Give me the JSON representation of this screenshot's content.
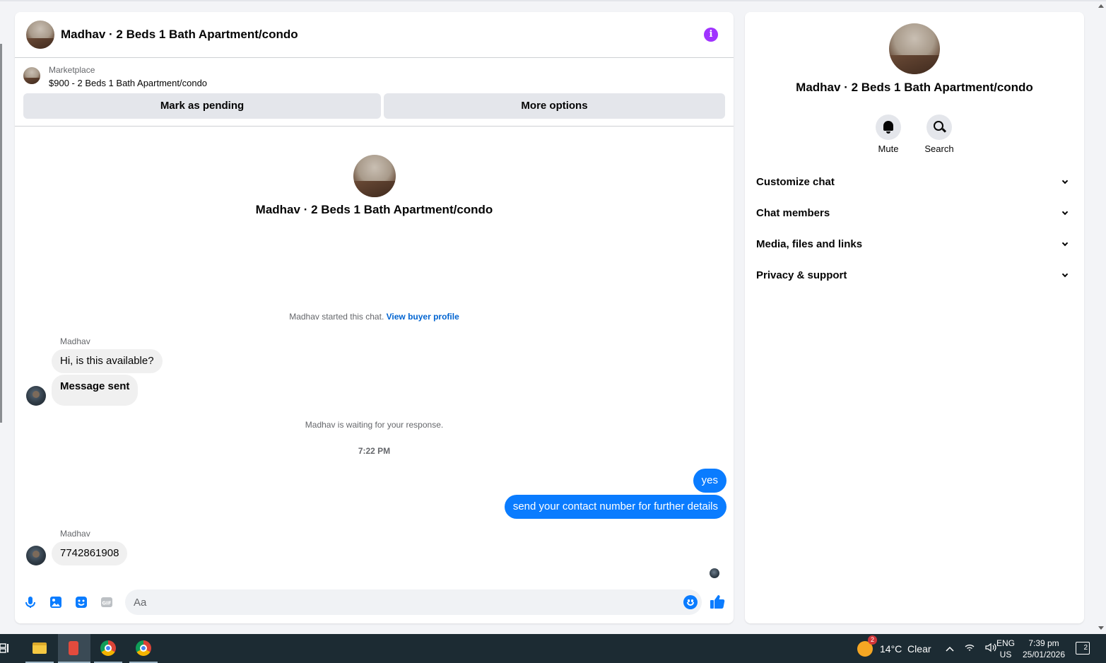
{
  "header": {
    "title": "Madhav · 2 Beds 1 Bath Apartment/condo",
    "info_icon": "info-icon"
  },
  "marketplace": {
    "label": "Marketplace",
    "listing": "$900 - 2 Beds 1 Bath Apartment/condo",
    "mark_pending": "Mark as pending",
    "more_options": "More options"
  },
  "intro": {
    "title": "Madhav · 2 Beds 1 Bath Apartment/condo"
  },
  "system": {
    "started": "Madhav started this chat.",
    "view_profile": "View buyer profile",
    "waiting": "Madhav is waiting for your response.",
    "time": "7:22 PM"
  },
  "messages": [
    {
      "sender": "Madhav",
      "text": "Hi, is this available?"
    },
    {
      "text": "Message sent"
    },
    {
      "text": "yes"
    },
    {
      "text": "send your contact number for further details"
    },
    {
      "sender": "Madhav",
      "text": "7742861908"
    }
  ],
  "composer": {
    "placeholder": "Aa"
  },
  "details": {
    "title": "Madhav · 2 Beds 1 Bath Apartment/condo",
    "mute": "Mute",
    "search": "Search",
    "sections": [
      "Customize chat",
      "Chat members",
      "Media, files and links",
      "Privacy & support"
    ]
  },
  "taskbar": {
    "weather_badge": "2",
    "weather": "14°C  Clear",
    "lang_top": "ENG",
    "lang_bottom": "US",
    "time": "7:39 pm",
    "date": "25/01/2026",
    "notif_count": "2"
  },
  "colors": {
    "accent": "#0a7cff",
    "info": "#a033ff",
    "link": "#0064d1"
  }
}
